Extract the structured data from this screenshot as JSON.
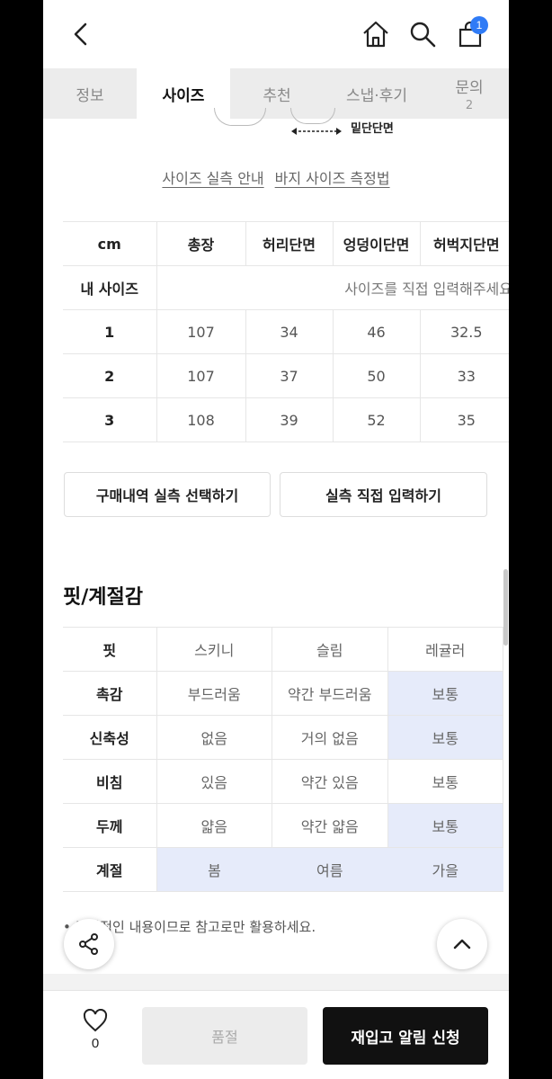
{
  "header": {
    "cart_count": "1",
    "badge_color": "#2f7bf6"
  },
  "tabs": [
    {
      "label": "정보",
      "count": ""
    },
    {
      "label": "사이즈",
      "count": ""
    },
    {
      "label": "추천",
      "count": ""
    },
    {
      "label": "스냅·후기",
      "count": ""
    },
    {
      "label": "문의",
      "count": "2"
    }
  ],
  "diagram": {
    "label": "밑단단면"
  },
  "links": {
    "size_guide": "사이즈 실측 안내",
    "pants_measure": "바지 사이즈 측정법"
  },
  "size_table": {
    "headers": [
      "cm",
      "총장",
      "허리단면",
      "엉덩이단면",
      "허벅지단면"
    ],
    "my_size_label": "내 사이즈",
    "my_size_placeholder": "사이즈를 직접 입력해주세요",
    "rows": [
      [
        "1",
        "107",
        "34",
        "46",
        "32.5"
      ],
      [
        "2",
        "107",
        "37",
        "50",
        "33"
      ],
      [
        "3",
        "108",
        "39",
        "52",
        "35"
      ]
    ]
  },
  "actions": {
    "purchase_history": "구매내역 실측 선택하기",
    "manual_input": "실측 직접 입력하기"
  },
  "fit": {
    "title": "핏/계절감",
    "rows": [
      {
        "label": "핏",
        "options": [
          "스키니",
          "슬림",
          "레귤러"
        ]
      },
      {
        "label": "촉감",
        "options": [
          "부드러움",
          "약간 부드러움",
          "보통"
        ]
      },
      {
        "label": "신축성",
        "options": [
          "없음",
          "거의 없음",
          "보통"
        ]
      },
      {
        "label": "비침",
        "options": [
          "있음",
          "약간 있음",
          "보통"
        ]
      },
      {
        "label": "두께",
        "options": [
          "얇음",
          "약간 얇음",
          "보통"
        ]
      },
      {
        "label": "계절",
        "options": [
          "봄",
          "여름",
          "가을"
        ]
      }
    ],
    "highlight_color": "#e6ebfa"
  },
  "note": "• 주관적인 내용이므로 참고로만 활용하세요.",
  "bottom": {
    "like_count": "0",
    "soldout_label": "품절",
    "restock_label": "재입고 알림 신청"
  }
}
